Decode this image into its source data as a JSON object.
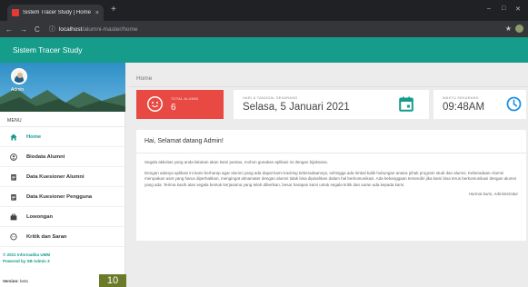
{
  "browser": {
    "tab_title": "Sistem Tracer Study | Home",
    "tab_close": "×",
    "new_tab": "+",
    "minimize": "–",
    "maximize": "□",
    "close": "✕",
    "nav": {
      "back": "←",
      "forward": "→",
      "reload": "C"
    },
    "url_host": "localhost",
    "url_path": "/alumni-master/home",
    "bookmark": "★"
  },
  "app": {
    "title": "Sistem Tracer Study"
  },
  "sidebar": {
    "profile_name": "Admin",
    "menu_heading": "MENU",
    "items": [
      {
        "label": "Home",
        "icon": "home-icon",
        "active": true
      },
      {
        "label": "Biodata Alumni",
        "icon": "account-icon",
        "active": false
      },
      {
        "label": "Data Kuesioner Alumni",
        "icon": "clipboard-icon",
        "active": false
      },
      {
        "label": "Data Kuesioner Pengguna",
        "icon": "clipboard-icon",
        "active": false
      },
      {
        "label": "Lowongan",
        "icon": "briefcase-icon",
        "active": false
      },
      {
        "label": "Kritik dan Saran",
        "icon": "comment-icon",
        "active": false
      }
    ],
    "footer_line1": "© 2021 Informatika UMM",
    "footer_line2": "Powered by SB Admin 3",
    "version_label": "Version:",
    "version_value": "beta"
  },
  "main": {
    "breadcrumb": "Home",
    "stats": {
      "total_label": "TOTAL ALUMNI",
      "total_value": "6",
      "date_label": "HARI & TANGGAL SEKARANG",
      "date_value": "Selasa, 5 Januari 2021",
      "time_label": "WAKTU SEKARANG",
      "time_value": "09:48AM"
    },
    "welcome": {
      "title": "Hai, Selamat datang Admin!",
      "intro": "Segala aktivitas yang anda lakukan akan kami pantau, mohon gunakan aplikasi ini dengan bijaksana.",
      "paragraph": "Dengan adanya aplikasi ini kami berharap agar alumni yang ada dapat kami tracking keberadaannya, sehingga ada timbal balik hubungan antara pihak program studi dan alumni. Keberadaan Alumni merupakan aset yang harus diperhatikan, mengingat almamater dengan alumni tidak bisa dipisahkan dalam hal berkomunikasi. Ada kebanggaan tersendiri jika kami bisa terus berkomunikasi dengan alumni yang ada. Terima kasih atas segala bentuk kerjasama yang telah diberikan, besar harapan kami untuk segala kritik dan saran ada kepada kami.",
      "signature": "Hormat kami, Administrator"
    }
  },
  "badge": "10",
  "colors": {
    "primary": "#159c8a",
    "danger": "#e84a43",
    "accent_blue": "#1d8fe3"
  }
}
